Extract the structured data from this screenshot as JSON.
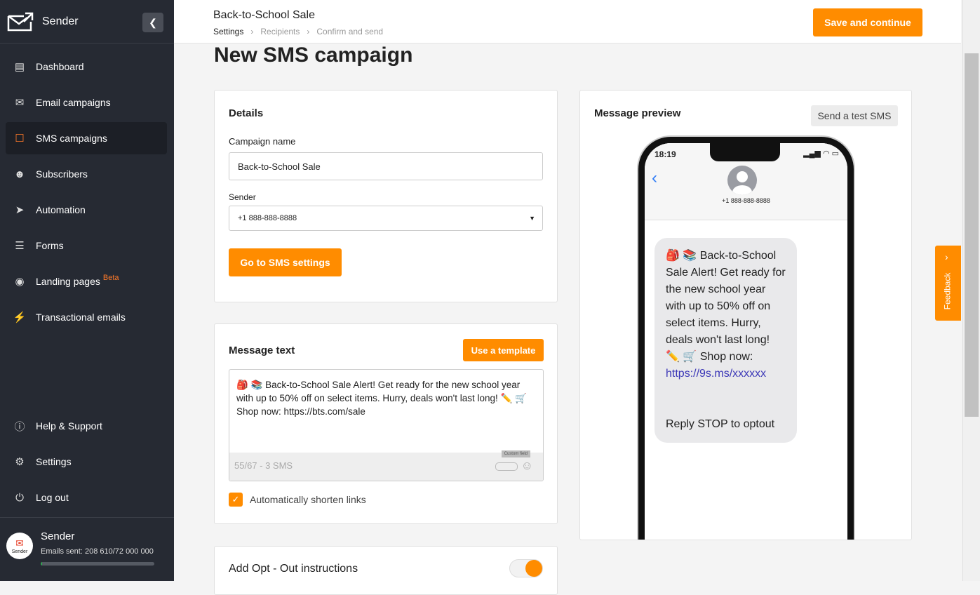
{
  "sidebar": {
    "brand": "Sender",
    "items": [
      {
        "label": "Dashboard",
        "icon": "monitor-icon"
      },
      {
        "label": "Email campaigns",
        "icon": "envelope-icon"
      },
      {
        "label": "SMS campaigns",
        "icon": "chat-icon",
        "active": true
      },
      {
        "label": "Subscribers",
        "icon": "users-icon"
      },
      {
        "label": "Automation",
        "icon": "paper-plane-icon"
      },
      {
        "label": "Forms",
        "icon": "form-icon"
      },
      {
        "label": "Landing pages",
        "icon": "globe-icon",
        "badge": "Beta"
      },
      {
        "label": "Transactional emails",
        "icon": "bolt-icon"
      }
    ],
    "bottom": [
      {
        "label": "Help & Support",
        "icon": "info-icon"
      },
      {
        "label": "Settings",
        "icon": "gear-icon"
      },
      {
        "label": "Log out",
        "icon": "power-icon"
      }
    ],
    "account": {
      "name": "Sender",
      "logo_text": "Sender",
      "emails_sent": "Emails sent: 208 610/72 000 000",
      "usage_percent": 0.29
    }
  },
  "header": {
    "title": "Back-to-School Sale",
    "breadcrumbs": [
      "Settings",
      "Recipients",
      "Confirm and send"
    ],
    "save_label": "Save and continue"
  },
  "page_title": "New SMS campaign",
  "details": {
    "title": "Details",
    "campaign_name_label": "Campaign name",
    "campaign_name": "Back-to-School Sale",
    "sender_label": "Sender",
    "sender": "+1 888-888-8888",
    "settings_button": "Go to SMS settings"
  },
  "message": {
    "title": "Message text",
    "template_button": "Use a template",
    "text": "🎒 📚 Back-to-School Sale Alert! Get ready for the new school year with up to 50% off on select items. Hurry, deals won't last long! ✏️ 🛒 Shop now: https://bts.com/sale",
    "counter": "55/67 - 3 SMS",
    "custom_field_tooltip": "Custom field",
    "shorten_label": "Automatically shorten links",
    "shorten_checked": true
  },
  "optout": {
    "title": "Add Opt - Out instructions",
    "enabled": true
  },
  "preview": {
    "title": "Message preview",
    "test_button": "Send a test SMS",
    "time": "18:19",
    "contact": "+1 888-888-8888",
    "body": "🎒 📚 Back-to-School Sale Alert! Get ready for the new school year with up to 50% off on select items. Hurry, deals won't last long! ✏️ 🛒 Shop now:",
    "link": "https://9s.ms/xxxxxx",
    "footer": "Reply STOP to optout"
  },
  "feedback": "Feedback",
  "colors": {
    "accent": "#ff8c00",
    "sidebar": "#262a33"
  }
}
